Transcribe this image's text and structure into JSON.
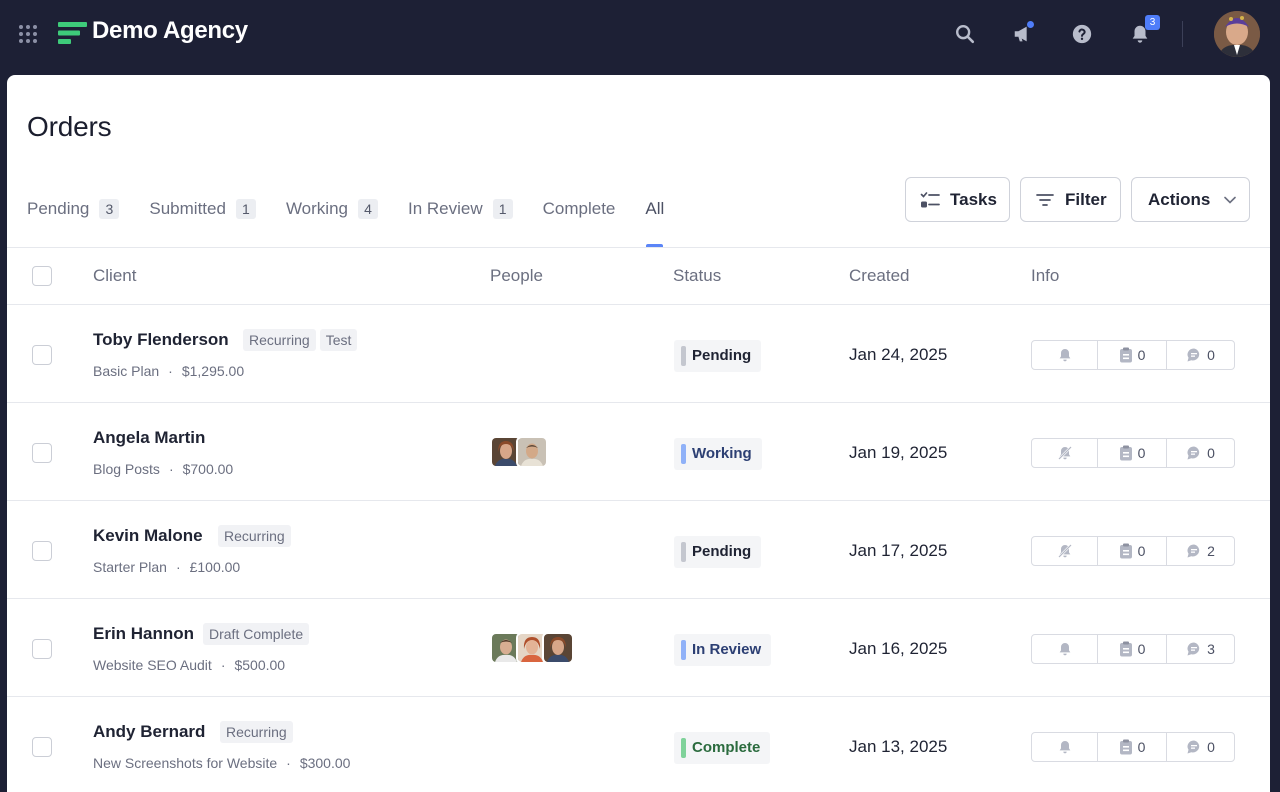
{
  "app": {
    "brand": "Demo Agency",
    "notification_count": "3"
  },
  "page": {
    "title": "Orders"
  },
  "tabs": [
    {
      "label": "Pending",
      "count": "3"
    },
    {
      "label": "Submitted",
      "count": "1"
    },
    {
      "label": "Working",
      "count": "4"
    },
    {
      "label": "In Review",
      "count": "1"
    },
    {
      "label": "Complete",
      "count": ""
    },
    {
      "label": "All",
      "count": "",
      "active": true
    }
  ],
  "toolbar": {
    "tasks_label": "Tasks",
    "filter_label": "Filter",
    "actions_label": "Actions"
  },
  "table": {
    "headers": {
      "client": "Client",
      "people": "People",
      "status": "Status",
      "created": "Created",
      "info": "Info"
    },
    "rows": [
      {
        "client": "Toby Flenderson",
        "tags": [
          "Recurring",
          "Test"
        ],
        "plan": "Basic Plan",
        "price": "$1,295.00",
        "people": [],
        "status": "Pending",
        "status_color": "#c4c7cf",
        "status_text_color": "#1f2333",
        "created": "Jan 24, 2025",
        "bell": "bell-icon",
        "tasks": "0",
        "messages": "0"
      },
      {
        "client": "Angela Martin",
        "tags": [],
        "plan": "Blog Posts",
        "price": "$700.00",
        "people": [
          "avatar-woman",
          "avatar-man"
        ],
        "status": "Working",
        "status_color": "#8fb1f8",
        "status_text_color": "#2c3f73",
        "created": "Jan 19, 2025",
        "bell": "bell-off-icon",
        "tasks": "0",
        "messages": "0"
      },
      {
        "client": "Kevin Malone",
        "tags": [
          "Recurring"
        ],
        "plan": "Starter Plan",
        "price": "£100.00",
        "people": [],
        "status": "Pending",
        "status_color": "#c4c7cf",
        "status_text_color": "#1f2333",
        "created": "Jan 17, 2025",
        "bell": "bell-off-icon",
        "tasks": "0",
        "messages": "2"
      },
      {
        "client": "Erin Hannon",
        "tags": [
          "Draft Complete"
        ],
        "plan": "Website SEO Audit",
        "price": "$500.00",
        "people": [
          "avatar-man",
          "avatar-woman",
          "avatar-woman"
        ],
        "status": "In Review",
        "status_color": "#8fb1f8",
        "status_text_color": "#2c3f73",
        "created": "Jan 16, 2025",
        "bell": "bell-icon",
        "tasks": "0",
        "messages": "3"
      },
      {
        "client": "Andy Bernard",
        "tags": [
          "Recurring"
        ],
        "plan": "New Screenshots for Website",
        "price": "$300.00",
        "people": [],
        "status": "Complete",
        "status_color": "#7fd29a",
        "status_text_color": "#2b6b3e",
        "created": "Jan 13, 2025",
        "bell": "bell-icon",
        "tasks": "0",
        "messages": "0"
      }
    ]
  }
}
